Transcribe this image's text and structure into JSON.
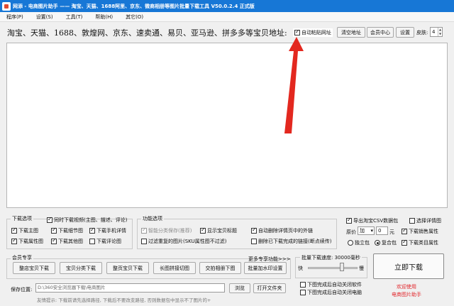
{
  "window": {
    "title": "网添 - 电商图片助手 —— 淘宝、天猫、1688阿里、京东、微商相册等图片批量下载工具 V50.0.2.4 正式版"
  },
  "menu": {
    "items": [
      "程序(P)",
      "设置(S)",
      "工具(T)",
      "帮助(H)",
      "其它(O)"
    ]
  },
  "address_bar": {
    "label": "淘宝、天猫、1688、敦煌网、京东、速卖通、易贝、亚马逊、拼多多等宝贝地址:",
    "auto_paste_label": "自动粘贴网址",
    "auto_paste_checked": true,
    "clear_button": "清空地址",
    "member_center_button": "会员中心",
    "settings_button": "设置",
    "skin_label": "皮肤:",
    "skin_value": "4"
  },
  "url_textarea": {
    "value": ""
  },
  "download_options": {
    "title": "下载选项",
    "items": [
      {
        "label": "同时下载视频(主图、描述、评论)",
        "checked": true
      },
      {
        "label": "下载主图",
        "checked": true
      },
      {
        "label": "下载细节图",
        "checked": true
      },
      {
        "label": "下载手机详情",
        "checked": true
      },
      {
        "label": "下载属性图",
        "checked": true
      },
      {
        "label": "下载其他图",
        "checked": true
      },
      {
        "label": "下载评论图",
        "checked": false
      }
    ]
  },
  "function_options": {
    "title": "功能选项",
    "items": [
      {
        "label": "智能分类保存(推荐)",
        "checked": true,
        "disabled": true
      },
      {
        "label": "显示宝贝标题",
        "checked": true
      },
      {
        "label": "自动删除详情页中的外链",
        "checked": true
      },
      {
        "label": "过滤重复的图片(SKU属性图不过滤)",
        "checked": false
      },
      {
        "label": "删除已下载完成的链接(断点续传)",
        "checked": false
      }
    ]
  },
  "right_options": {
    "export_csv": {
      "label": "导出淘宝CSV数据包",
      "checked": true
    },
    "detail_images": {
      "label": "选择详情图",
      "checked": false
    },
    "price_label": "原价",
    "price_op": "加",
    "price_value": "0",
    "price_unit": "元",
    "download_sales_attr": {
      "label": "下载销售属性",
      "checked": true
    },
    "standalone_pack": {
      "label": "独立包",
      "selected": false
    },
    "combined_pack": {
      "label": "复合包",
      "selected": true
    },
    "download_category_attr": {
      "label": "下载类目属性",
      "checked": true
    }
  },
  "member_section": {
    "title": "会员专享",
    "more_link": "更多专享功能>>>",
    "buttons": [
      "整店宝贝下载",
      "宝贝分类下载",
      "整页宝贝下载",
      "长图拼接切图",
      "交拍相册下图",
      "批量加水印设置"
    ]
  },
  "speed": {
    "label": "批量下载速度: 30000毫秒",
    "fast_label": "快",
    "slow_label": "慢",
    "level": 0.68
  },
  "after_download": {
    "close_software": {
      "label": "下图完成后自动关闭软件",
      "checked": false
    },
    "shutdown": {
      "label": "下图完成后自动关闭电脑",
      "checked": false
    }
  },
  "download_button": "立即下载",
  "welcome": {
    "line1": "欢迎使用",
    "line2": "电商图片助手"
  },
  "save": {
    "label": "保存位置:",
    "path": "D:\\360安全浏览器下载\\电商图片",
    "browse_button": "浏览",
    "open_folder_button": "打开文件夹",
    "hint": "友情提示: 下载前请先选择路径, 下载后不要改变路径, 否则数据包中显示不了图片的+"
  },
  "colors": {
    "titlebar": "#1777d6",
    "arrow": "#e3281f",
    "welcome": "#e2252a"
  }
}
